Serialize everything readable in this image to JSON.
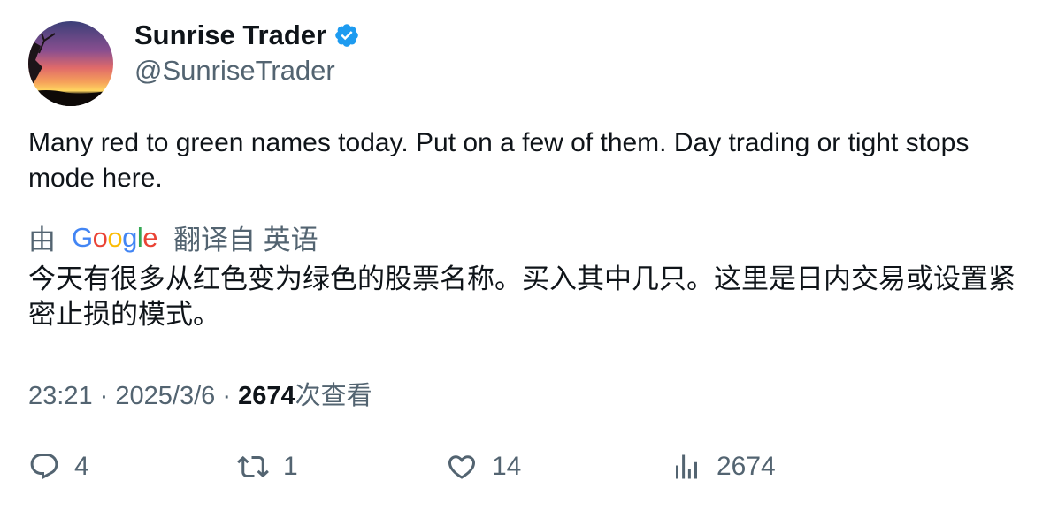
{
  "author": {
    "display_name": "Sunrise Trader",
    "handle": "@SunriseTrader",
    "verified_icon": "verified-badge-icon",
    "badge_color": "#1d9bf0"
  },
  "tweet": {
    "text": "Many red to green names today. Put on a few of them. Day trading or tight stops mode here."
  },
  "translation": {
    "prefix": "由",
    "provider_letters": [
      "G",
      "o",
      "o",
      "g",
      "l",
      "e"
    ],
    "provider_colors": [
      "#4285F4",
      "#EA4335",
      "#FBBC05",
      "#4285F4",
      "#34A853",
      "#EA4335"
    ],
    "suffix": "翻译自 英语",
    "text": "今天有很多从红色变为绿色的股票名称。买入其中几只。这里是日内交易或设置紧密止损的模式。"
  },
  "meta": {
    "time": "23:21",
    "separator": "·",
    "date": "2025/3/6",
    "views_count": "2674",
    "views_label": "次查看"
  },
  "actions": {
    "reply_count": "4",
    "retweet_count": "1",
    "like_count": "14",
    "views_count": "2674"
  }
}
